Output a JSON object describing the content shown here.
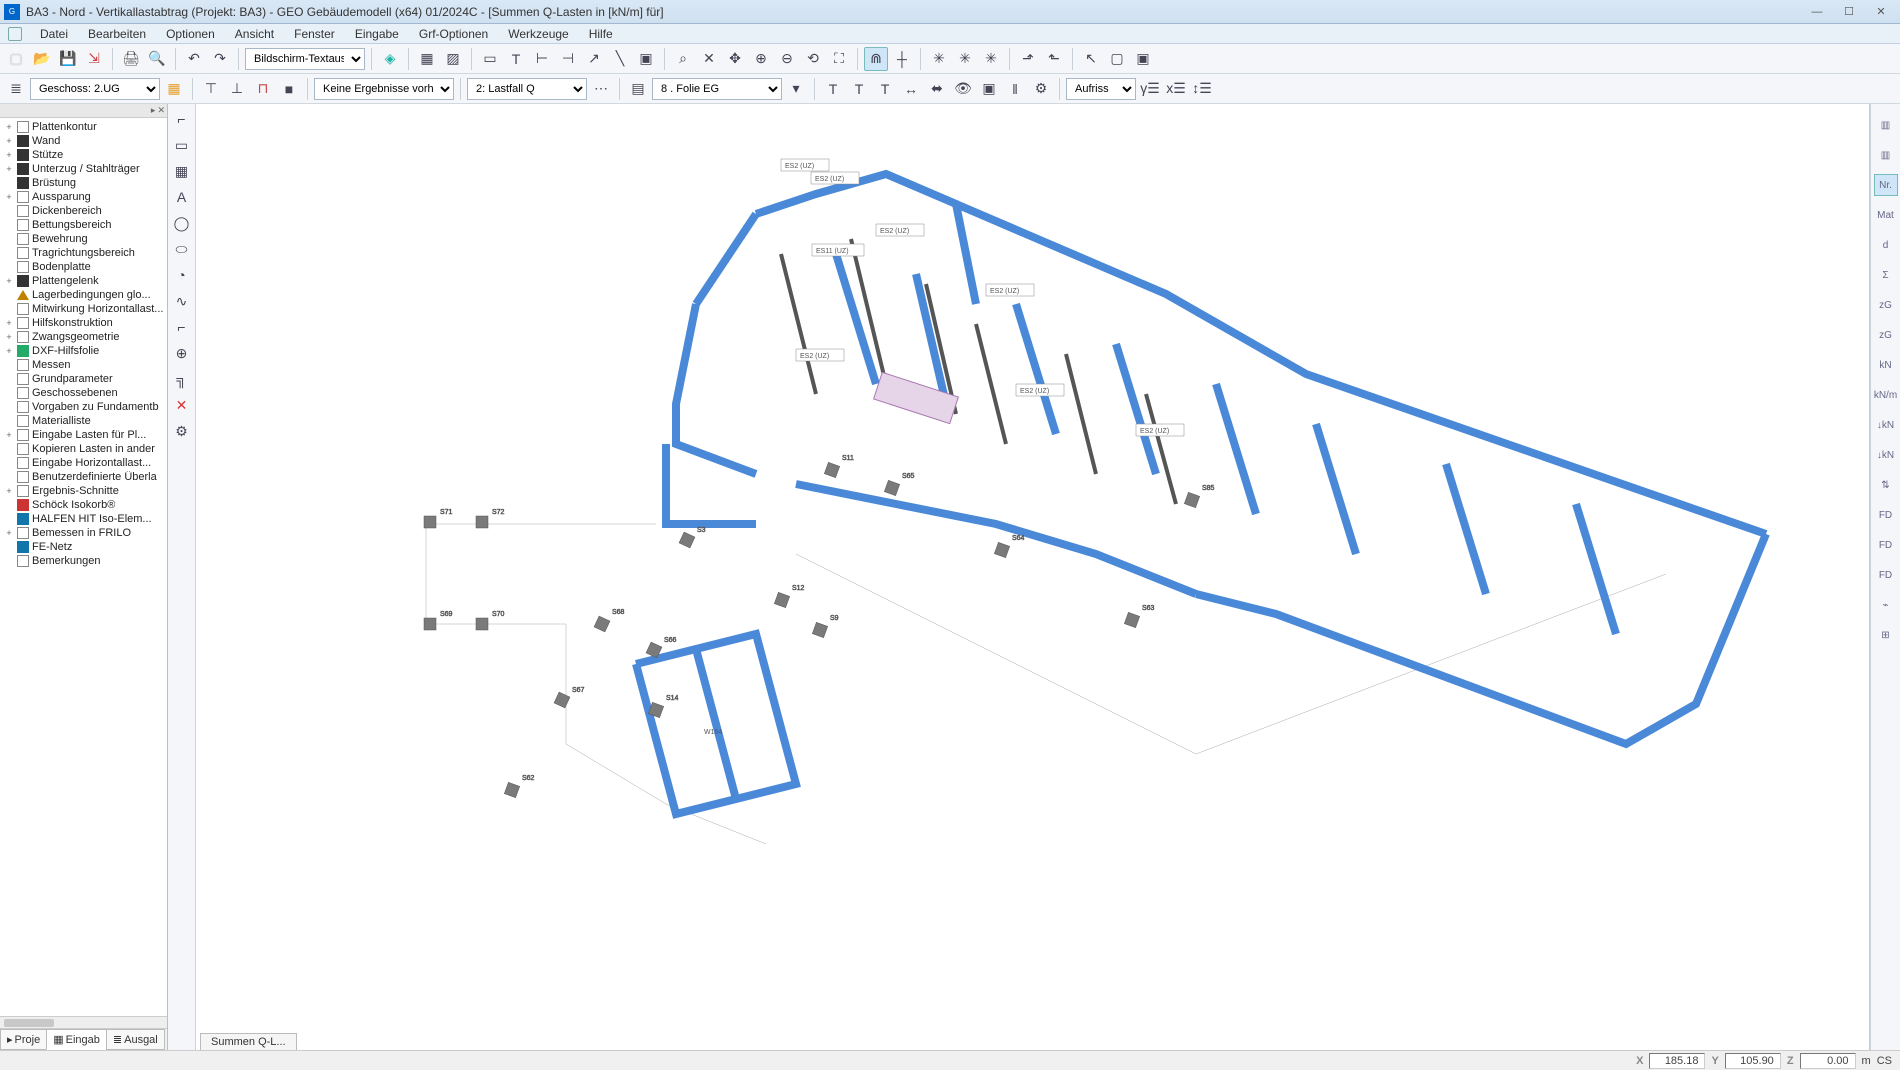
{
  "title": "BA3 - Nord - Vertikallastabtrag (Projekt: BA3) - GEO Gebäudemodell (x64) 01/2024C - [Summen Q-Lasten in [kN/m] für]",
  "menu": [
    "Datei",
    "Bearbeiten",
    "Optionen",
    "Ansicht",
    "Fenster",
    "Eingabe",
    "Grf-Optionen",
    "Werkzeuge",
    "Hilfe"
  ],
  "toolbar2": {
    "geschoss_label": "Geschoss: 2.UG",
    "select1": "Bildschirm-Textausg",
    "select2": "Keine Ergebnisse vorhand",
    "select3": "2: Lastfall Q",
    "select4": "8 . Folie EG",
    "select5": "Aufriss"
  },
  "tree": [
    {
      "label": "Plattenkontur",
      "exp": "+",
      "ico": ""
    },
    {
      "label": "Wand",
      "exp": "+",
      "ico": "filled"
    },
    {
      "label": "Stütze",
      "exp": "+",
      "ico": "filled"
    },
    {
      "label": "Unterzug / Stahlträger",
      "exp": "+",
      "ico": "filled"
    },
    {
      "label": "Brüstung",
      "exp": "",
      "ico": "filled"
    },
    {
      "label": "Aussparung",
      "exp": "+",
      "ico": ""
    },
    {
      "label": "Dickenbereich",
      "exp": "",
      "ico": ""
    },
    {
      "label": "Bettungsbereich",
      "exp": "",
      "ico": ""
    },
    {
      "label": "Bewehrung",
      "exp": "",
      "ico": ""
    },
    {
      "label": "Tragrichtungsbereich",
      "exp": "",
      "ico": ""
    },
    {
      "label": "Bodenplatte",
      "exp": "",
      "ico": ""
    },
    {
      "label": "Plattengelenk",
      "exp": "+",
      "ico": "filled"
    },
    {
      "label": "Lagerbedingungen glo...",
      "exp": "",
      "ico": "tri"
    },
    {
      "label": "Mitwirkung Horizontallast...",
      "exp": "",
      "ico": ""
    },
    {
      "label": "Hilfskonstruktion",
      "exp": "+",
      "ico": ""
    },
    {
      "label": "Zwangsgeometrie",
      "exp": "+",
      "ico": ""
    },
    {
      "label": "DXF-Hilfsfolie",
      "exp": "+",
      "ico": "green"
    },
    {
      "label": "Messen",
      "exp": "",
      "ico": ""
    },
    {
      "label": "Grundparameter",
      "exp": "",
      "ico": ""
    },
    {
      "label": "Geschossebenen",
      "exp": "",
      "ico": ""
    },
    {
      "label": "Vorgaben zu Fundamentb",
      "exp": "",
      "ico": ""
    },
    {
      "label": "Materialliste",
      "exp": "",
      "ico": ""
    },
    {
      "label": "Eingabe Lasten für Pl...",
      "exp": "+",
      "ico": ""
    },
    {
      "label": "Kopieren Lasten in ander",
      "exp": "",
      "ico": ""
    },
    {
      "label": "Eingabe Horizontallast...",
      "exp": "",
      "ico": ""
    },
    {
      "label": "Benutzerdefinierte Überla",
      "exp": "",
      "ico": ""
    },
    {
      "label": "Ergebnis-Schnitte",
      "exp": "+",
      "ico": ""
    },
    {
      "label": "Schöck Isokorb®",
      "exp": "",
      "ico": "red"
    },
    {
      "label": "HALFEN HIT Iso-Elem...",
      "exp": "",
      "ico": "blue"
    },
    {
      "label": "Bemessen in FRILO",
      "exp": "+",
      "ico": ""
    },
    {
      "label": "FE-Netz",
      "exp": "",
      "ico": "blue"
    },
    {
      "label": "Bemerkungen",
      "exp": "",
      "ico": ""
    }
  ],
  "left_tabs": [
    "Proje",
    "Eingab",
    "Ausgal"
  ],
  "canvas_tab": "Summen Q-L...",
  "right_buttons": [
    "▥",
    "▥",
    "Nr.",
    "Mat",
    "d",
    "Σ",
    "zG",
    "zG",
    "kN",
    "kN/m",
    "↓kN",
    "↓kN",
    "⇅",
    "FD",
    "FD",
    "FD",
    "⌁",
    "⊞"
  ],
  "status": {
    "x": "185.18",
    "y": "105.90",
    "z": "0.00",
    "unit": "m",
    "cs": "CS"
  },
  "drawing_labels": [
    "ES2 (UZ)",
    "ES2 (UZ)",
    "ES2 (UZ)",
    "ES2 (UZ)",
    "ES2 (UZ)",
    "ES2 (UZ)",
    "ES2 (UZ)",
    "ES11 (UZ)"
  ],
  "support_labels": {
    "s71": "S71",
    "s72": "S72",
    "s69": "S69",
    "s70": "S70",
    "s68": "S68",
    "s66": "S66",
    "s67": "S67",
    "s3": "S3",
    "s11": "S11",
    "s12": "S12",
    "s9": "S9",
    "s65": "S65",
    "s64": "S64",
    "s63": "S63",
    "s85": "S85",
    "s14": "S14",
    "s62": "S62",
    "w164": "W164"
  }
}
